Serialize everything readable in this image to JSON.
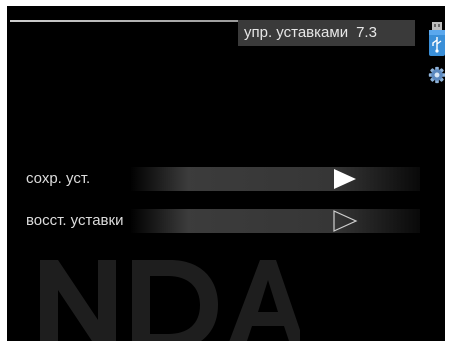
{
  "header": {
    "title": "упр. уставками",
    "menu_number": "7.3"
  },
  "side_icons": [
    "usb-icon",
    "gear-icon"
  ],
  "menu": {
    "items": [
      {
        "label": "сохр. уст.",
        "arrow": "filled"
      },
      {
        "label": "восст. уставки",
        "arrow": "outline"
      }
    ]
  },
  "colors": {
    "background": "#000000",
    "title_box": "#3a3a3a",
    "text": "#dcdcdc",
    "usb_icon": "#3a8fd8"
  }
}
